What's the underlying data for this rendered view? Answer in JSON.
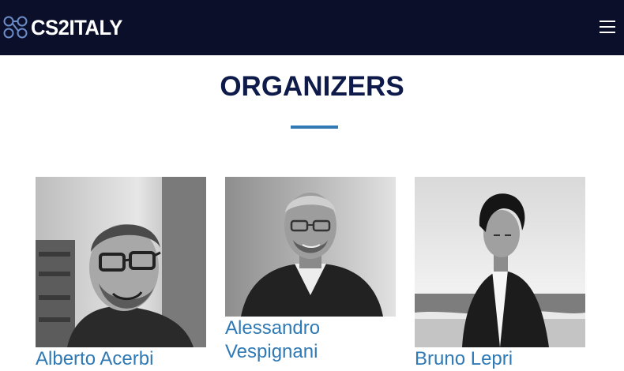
{
  "header": {
    "logo_text": "CS2ITALY"
  },
  "main": {
    "section_title": "ORGANIZERS",
    "organizers": [
      {
        "first": "Alberto",
        "last": "Acerbi"
      },
      {
        "first": "Alessandro",
        "last": "Vespignani"
      },
      {
        "first": "Bruno",
        "last": "Lepri"
      }
    ]
  },
  "colors": {
    "navbar_bg": "#0b0f2a",
    "title": "#0e1a4a",
    "accent": "#2f79b5"
  },
  "icons": {
    "logo_mark": "linked-circles-icon",
    "menu": "hamburger-menu-icon"
  }
}
